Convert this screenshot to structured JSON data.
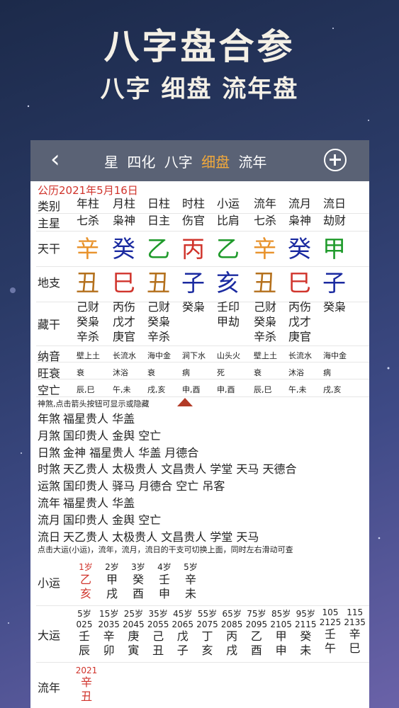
{
  "header": {
    "title": "八字盘合参",
    "subtitle": "八字 细盘 流年盘"
  },
  "colors": {
    "wood": "#1e9a2a",
    "fire": "#d0342c",
    "earth": "#b4701c",
    "metal": "#e8922b",
    "water": "#1a2aa0",
    "accent": "#f2a93b",
    "topbar": "#5a6275"
  },
  "nav": {
    "back_icon": "chevron-left-icon",
    "tabs": [
      "星",
      "四化",
      "八字",
      "细盘",
      "流年"
    ],
    "active_tab": "细盘",
    "add_icon": "plus-circle-icon"
  },
  "date": "公历2021年5月16日",
  "columns": [
    "年柱",
    "月柱",
    "日柱",
    "时柱",
    "小运",
    "流年",
    "流月",
    "流日"
  ],
  "labels": {
    "type": "类别",
    "main_star": "主星",
    "tiangan": "天干",
    "dizhi": "地支",
    "canggan": "藏干",
    "nayin": "纳音",
    "wangshuai": "旺衰",
    "kongwang": "空亡"
  },
  "main_star": [
    "七杀",
    "枭神",
    "日主",
    "伤官",
    "比肩",
    "七杀",
    "枭神",
    "劫财"
  ],
  "tiangan": [
    "辛",
    "癸",
    "乙",
    "丙",
    "乙",
    "辛",
    "癸",
    "甲"
  ],
  "dizhi": [
    "丑",
    "巳",
    "丑",
    "子",
    "亥",
    "丑",
    "巳",
    "子"
  ],
  "canggan": [
    [
      "己财",
      "癸枭",
      "辛杀"
    ],
    [
      "丙伤",
      "戊才",
      "庚官"
    ],
    [
      "己财",
      "癸枭",
      "辛杀"
    ],
    [
      "癸枭",
      "",
      ""
    ],
    [
      "壬印",
      "甲劫",
      ""
    ],
    [
      "己财",
      "癸枭",
      "辛杀"
    ],
    [
      "丙伤",
      "戊才",
      "庚官"
    ],
    [
      "癸枭",
      "",
      ""
    ]
  ],
  "nayin": [
    "壁上土",
    "长流水",
    "海中金",
    "涧下水",
    "山头火",
    "壁上土",
    "长流水",
    "海中金"
  ],
  "wangshuai": [
    "衰",
    "沐浴",
    "衰",
    "病",
    "死",
    "衰",
    "沐浴",
    "病"
  ],
  "kongwang": [
    "辰,巳",
    "午,未",
    "戌,亥",
    "申,酉",
    "申,酉",
    "辰,巳",
    "午,未",
    "戌,亥"
  ],
  "shensha_note": "神煞,点击箭头按钮可显示或隐藏",
  "shensha": [
    {
      "label": "年煞",
      "items": "福星贵人 华盖"
    },
    {
      "label": "月煞",
      "items": "国印贵人 金舆 空亡"
    },
    {
      "label": "日煞",
      "items": "金神 福星贵人 华盖 月德合"
    },
    {
      "label": "时煞",
      "items": "天乙贵人 太极贵人 文昌贵人 学堂 天马 天德合"
    },
    {
      "label": "运煞",
      "items": "国印贵人 驿马 月德合 空亡 吊客"
    },
    {
      "label": "流年",
      "items": "福星贵人 华盖"
    },
    {
      "label": "流月",
      "items": "国印贵人 金舆 空亡"
    },
    {
      "label": "流日",
      "items": "天乙贵人 太极贵人 文昌贵人 学堂 天马"
    }
  ],
  "switch_note": "点击大运(小运)，流年，流月，流日的干支可切换上面，同时左右滑动可查",
  "xiaoyun": {
    "label": "小运",
    "ages": [
      "1岁",
      "2岁",
      "3岁",
      "4岁",
      "5岁"
    ],
    "gan": [
      "乙",
      "甲",
      "癸",
      "壬",
      "辛"
    ],
    "zhi": [
      "亥",
      "戌",
      "酉",
      "申",
      "未"
    ]
  },
  "dayun": {
    "label": "大运",
    "ages": [
      "5岁",
      "15岁",
      "25岁",
      "35岁",
      "45岁",
      "55岁",
      "65岁",
      "75岁",
      "85岁",
      "95岁",
      "105",
      "115"
    ],
    "years": [
      "025",
      "2035",
      "2045",
      "2055",
      "2065",
      "2075",
      "2085",
      "2095",
      "2105",
      "2115",
      "2125",
      "2135"
    ],
    "gan": [
      "壬",
      "辛",
      "庚",
      "己",
      "戊",
      "丁",
      "丙",
      "乙",
      "甲",
      "癸",
      "壬",
      "辛"
    ],
    "zhi": [
      "辰",
      "卯",
      "寅",
      "丑",
      "子",
      "亥",
      "戌",
      "酉",
      "申",
      "未",
      "午",
      "巳"
    ]
  },
  "liunian": {
    "label": "流年",
    "year": "2021",
    "gan": "辛",
    "zhi": "丑"
  }
}
